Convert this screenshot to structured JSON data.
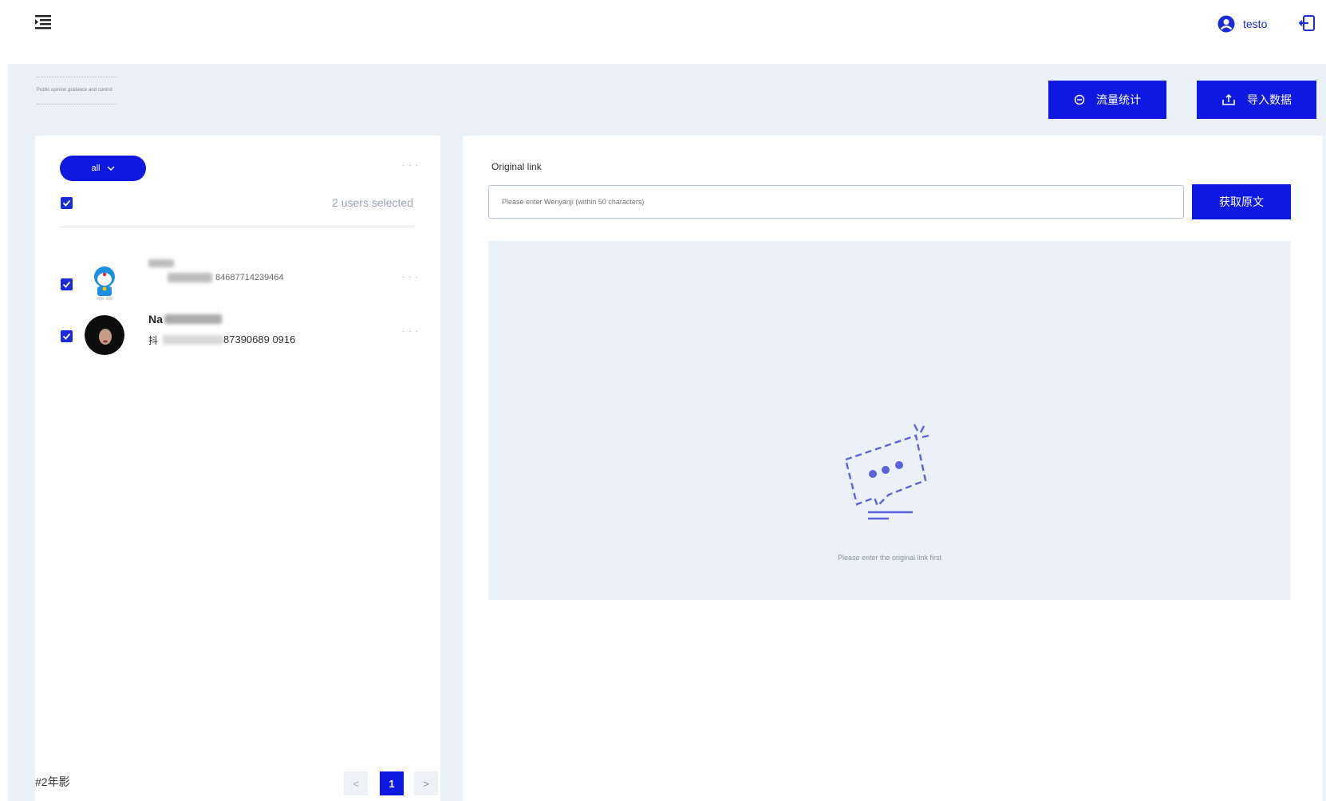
{
  "topbar": {
    "username": "testo"
  },
  "page": {
    "subtitle": "Public opinion guidance and control"
  },
  "actions": {
    "stat_label": "流量统计",
    "import_label": "导入数据"
  },
  "user_panel": {
    "filter_label": "all",
    "more": "· · ·",
    "selected_count": "2 users selected",
    "users": [
      {
        "id_text": "84687714239464",
        "name": "",
        "more": "· · ·"
      },
      {
        "name": "Na",
        "id_text": "87390689 0916",
        "prefix": "抖",
        "more": "· · ·"
      }
    ],
    "footer_note": "#2年影",
    "pager": {
      "prev": "<",
      "current": "1",
      "next": ">"
    }
  },
  "right_panel": {
    "original_link_label": "Original link",
    "input_placeholder": "Please enter Wenyanji (within 50 characters)",
    "fetch_label": "获取原文",
    "empty_text": "Please enter the original link first"
  },
  "colors": {
    "accent": "#0f18e0",
    "workspace_bg": "#eaf1f8",
    "panel_bg": "#ffffff"
  }
}
